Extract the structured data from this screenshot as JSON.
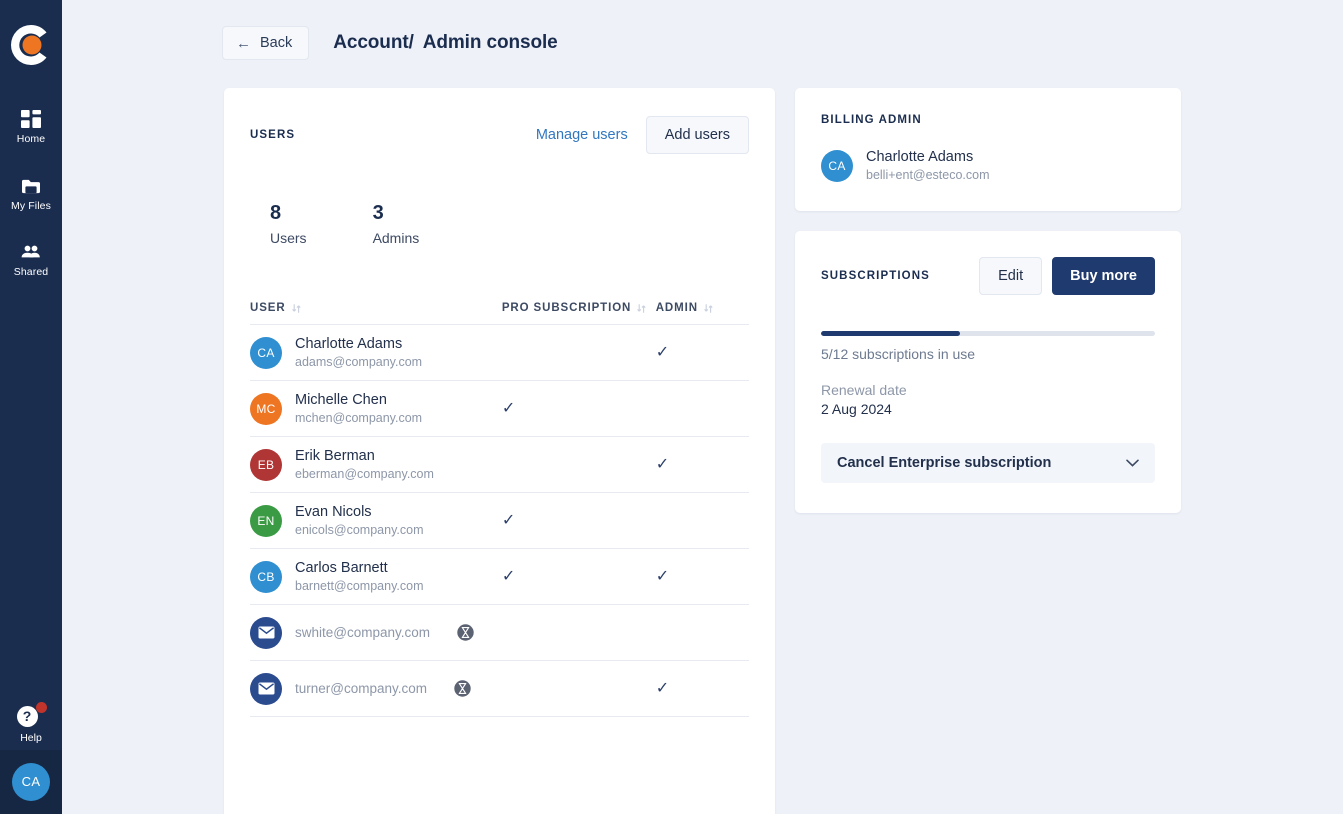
{
  "sidebar": {
    "logo_name": "company-logo",
    "items": [
      {
        "label": "Home",
        "icon": "grid-icon"
      },
      {
        "label": "My Files",
        "icon": "folder-icon"
      },
      {
        "label": "Shared",
        "icon": "people-icon"
      }
    ],
    "help": {
      "label": "Help",
      "glyph": "?",
      "has_notification": true
    },
    "user_avatar": {
      "initials": "CA",
      "color": "#2f8fd0"
    }
  },
  "header": {
    "back_label": "Back",
    "back_arrow": "←",
    "breadcrumb_root": "Account",
    "breadcrumb_sep": "/",
    "breadcrumb_current": "Admin console"
  },
  "users_panel": {
    "title": "USERS",
    "manage_label": "Manage users",
    "add_label": "Add users",
    "stats": [
      {
        "value": "8",
        "label": "Users"
      },
      {
        "value": "3",
        "label": "Admins"
      }
    ],
    "columns": [
      {
        "label": "USER",
        "sortable": true
      },
      {
        "label": "PRO SUBSCRIPTION",
        "sortable": true
      },
      {
        "label": "ADMIN",
        "sortable": true
      }
    ],
    "check_glyph": "✓",
    "rows": [
      {
        "type": "member",
        "initials": "CA",
        "color": "#2f8fd0",
        "name": "Charlotte Adams",
        "email": "adams@company.com",
        "pro": false,
        "admin": true,
        "pending": false
      },
      {
        "type": "member",
        "initials": "MC",
        "color": "#ee7522",
        "name": "Michelle Chen",
        "email": "mchen@company.com",
        "pro": true,
        "admin": false,
        "pending": false
      },
      {
        "type": "member",
        "initials": "EB",
        "color": "#b03535",
        "name": "Erik Berman",
        "email": "eberman@company.com",
        "pro": false,
        "admin": true,
        "pending": false
      },
      {
        "type": "member",
        "initials": "EN",
        "color": "#3b9b45",
        "name": "Evan Nicols",
        "email": "enicols@company.com",
        "pro": true,
        "admin": false,
        "pending": false
      },
      {
        "type": "member",
        "initials": "CB",
        "color": "#2f8fd0",
        "name": "Carlos Barnett",
        "email": "barnett@company.com",
        "pro": true,
        "admin": true,
        "pending": false
      },
      {
        "type": "invite",
        "initials": "",
        "color": "#2b4b8f",
        "name": "",
        "email": "swhite@company.com",
        "pro": false,
        "admin": false,
        "pending": true
      },
      {
        "type": "invite",
        "initials": "",
        "color": "#2b4b8f",
        "name": "",
        "email": "turner@company.com",
        "pro": false,
        "admin": true,
        "pending": true
      }
    ]
  },
  "billing_panel": {
    "title": "BILLING ADMIN",
    "admin": {
      "initials": "CA",
      "color": "#2f8fd0",
      "name": "Charlotte Adams",
      "email": "belli+ent@esteco.com"
    }
  },
  "subscriptions_panel": {
    "title": "SUBSCRIPTIONS",
    "edit_label": "Edit",
    "buy_label": "Buy more",
    "used": 5,
    "total": 12,
    "usage_text": "5/12 subscriptions in use",
    "renewal_label": "Renewal date",
    "renewal_date": "2 Aug 2024",
    "cancel_label": "Cancel Enterprise subscription",
    "chevron": "⌄",
    "bar_fill_color": "#1f3a6e",
    "bar_track_color": "#dfe4ec"
  },
  "theme": {
    "sidebar_bg": "#1b2d4f",
    "page_bg": "#eef1f7",
    "accent_blue": "#3277c0",
    "primary_navy": "#1f3a6e",
    "logo_orange": "#ee7522"
  }
}
